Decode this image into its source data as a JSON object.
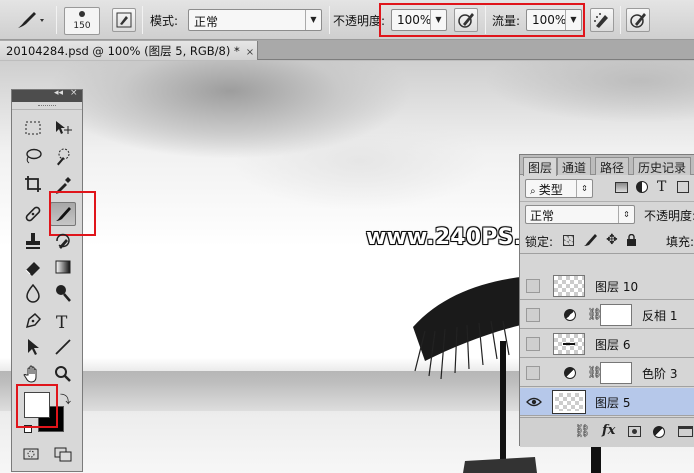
{
  "options_bar": {
    "brush_size": "150",
    "mode_label": "模式:",
    "mode_value": "正常",
    "opacity_label": "不透明度:",
    "opacity_value": "100%",
    "flow_label": "流量:",
    "flow_value": "100%"
  },
  "document_tab": {
    "title": "20104284.psd @ 100% (图层 5, RGB/8) *",
    "close": "×"
  },
  "watermark": "www.240PS.com",
  "tools_panel": {
    "collapse": "◂◂",
    "close": "×",
    "selected_tool": "brush-tool"
  },
  "layers_panel": {
    "tabs": [
      "图层",
      "通道",
      "路径",
      "历史记录"
    ],
    "filter_label": "类型",
    "blend_mode": "正常",
    "opacity_label": "不透明度:",
    "lock_label": "锁定:",
    "fill_label": "填充:",
    "layers": [
      {
        "name": "图层 10",
        "visible": false,
        "selected": false,
        "adjustment": false
      },
      {
        "name": "反相 1",
        "visible": false,
        "selected": false,
        "adjustment": true
      },
      {
        "name": "图层 6",
        "visible": false,
        "selected": false,
        "adjustment": false
      },
      {
        "name": "色阶 3",
        "visible": false,
        "selected": false,
        "adjustment": true
      },
      {
        "name": "图层 5",
        "visible": true,
        "selected": true,
        "adjustment": false
      }
    ],
    "footer_fx": "fx"
  },
  "colors": {
    "highlight_red": "#e0151b",
    "selected_layer": "#b6c8ea",
    "foreground": "#ffffff",
    "background": "#000000"
  }
}
